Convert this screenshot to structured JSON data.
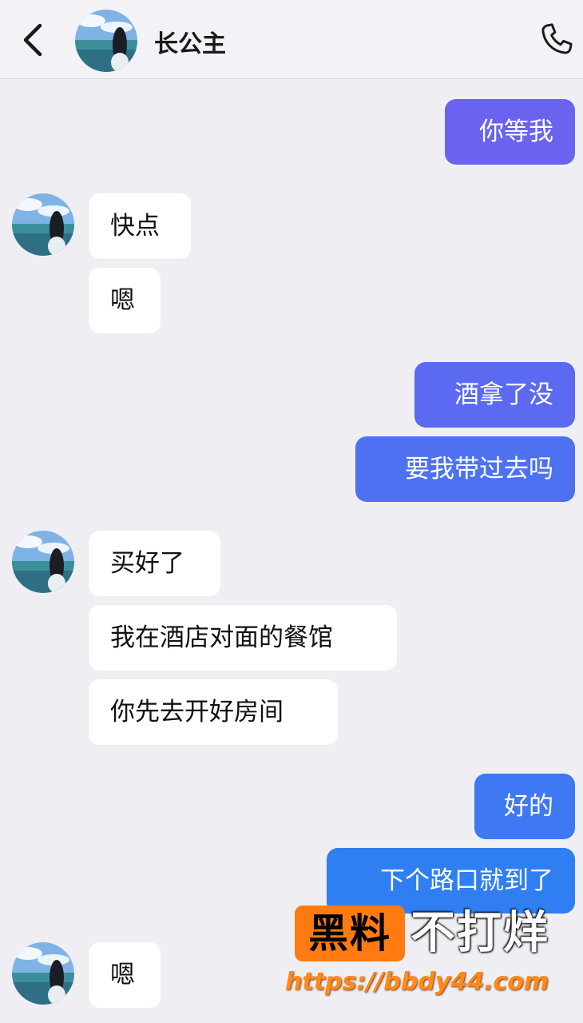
{
  "header": {
    "title": "长公主",
    "back_icon": "chevron-left-icon",
    "call_icon": "phone-icon"
  },
  "colors": {
    "background": "#efeef3",
    "incoming_bubble": "#ffffff",
    "outgoing_gradient_start": "#6a63f0",
    "outgoing_gradient_end": "#2f7ff2"
  },
  "messages": [
    {
      "side": "out",
      "text": "你等我"
    },
    {
      "side": "in",
      "text": "快点"
    },
    {
      "side": "in",
      "text": "嗯"
    },
    {
      "side": "out",
      "text": "酒拿了没"
    },
    {
      "side": "out",
      "text": "要我带过去吗"
    },
    {
      "side": "in",
      "text": "买好了"
    },
    {
      "side": "in",
      "text": "我在酒店对面的餐馆"
    },
    {
      "side": "in",
      "text": "你先去开好房间"
    },
    {
      "side": "out",
      "text": "好的"
    },
    {
      "side": "out",
      "text": "下个路口就到了"
    },
    {
      "side": "in",
      "text": "嗯"
    }
  ],
  "watermark": {
    "badge": "黑料",
    "text": "不打烊",
    "url": "https://bbdy44.com"
  }
}
